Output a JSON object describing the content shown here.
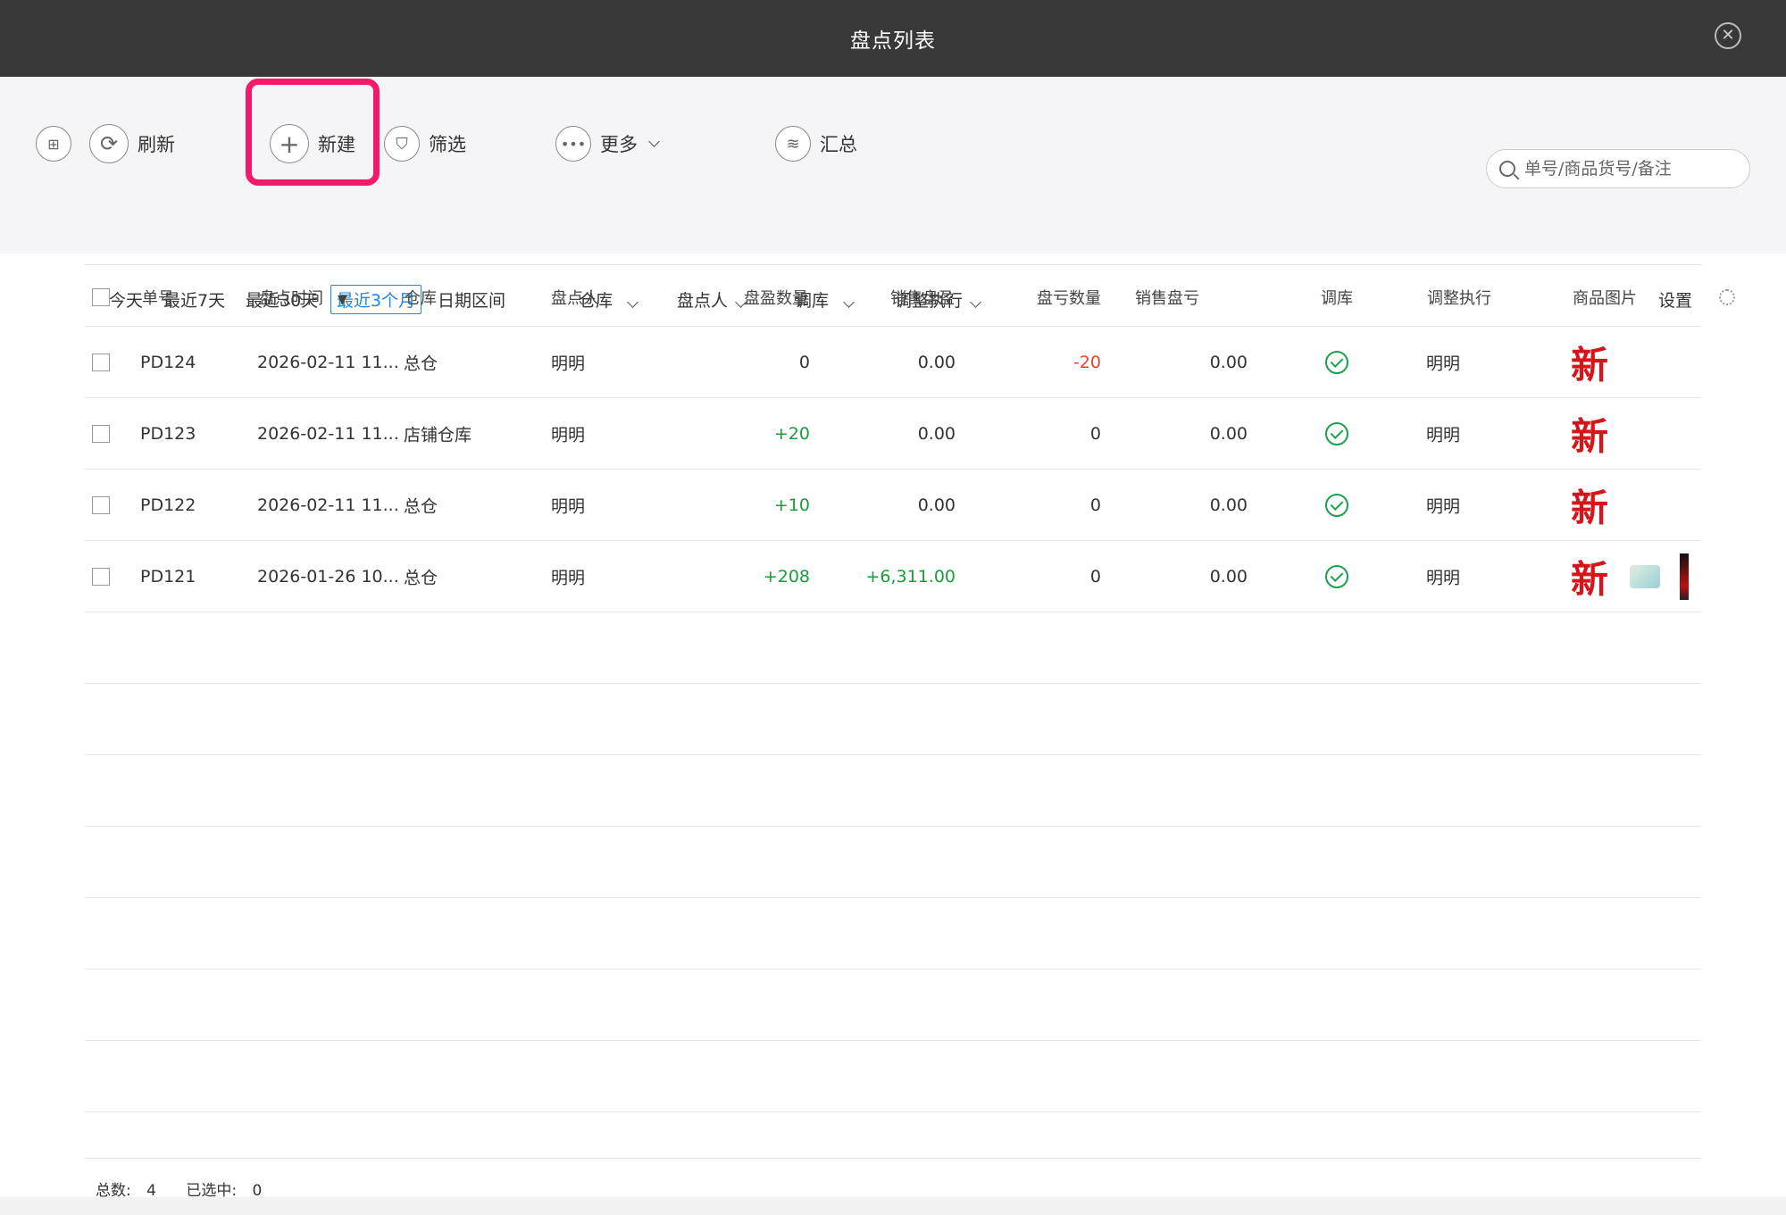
{
  "window": {
    "title": "盘点列表"
  },
  "toolbar": {
    "refresh_label": "刷新",
    "new_label": "新建",
    "filter_label": "筛选",
    "more_label": "更多",
    "summary_label": "汇总",
    "search_placeholder": "单号/商品货号/备注"
  },
  "filters": {
    "today": "今天",
    "last7": "最近7天",
    "last30": "最近30天",
    "last3m": "最近3个月",
    "range": "日期区间",
    "warehouse": "仓库",
    "counter": "盘点人",
    "adjust": "调库",
    "executor": "调整执行",
    "settings": "设置"
  },
  "table": {
    "columns": {
      "id": "单号",
      "time": "盘点时间",
      "sort_marker": "▼",
      "warehouse": "仓库",
      "counter": "盘点人",
      "gain_qty": "盘盈数量",
      "sales_gain": "销售盘盈",
      "loss_qty": "盘亏数量",
      "sales_loss": "销售盘亏",
      "adjust": "调库",
      "executor": "调整执行",
      "images": "商品图片"
    },
    "rows": [
      {
        "id": "PD124",
        "time": "2026-02-11 11...",
        "warehouse": "总仓",
        "counter": "明明",
        "gain_qty": "0",
        "sales_gain": "0.00",
        "loss_qty": "-20",
        "sales_loss": "0.00",
        "executor": "明明",
        "img": "新"
      },
      {
        "id": "PD123",
        "time": "2026-02-11 11...",
        "warehouse": "店铺仓库",
        "counter": "明明",
        "gain_qty": "+20",
        "sales_gain": "0.00",
        "loss_qty": "0",
        "sales_loss": "0.00",
        "executor": "明明",
        "img": "新"
      },
      {
        "id": "PD122",
        "time": "2026-02-11 11...",
        "warehouse": "总仓",
        "counter": "明明",
        "gain_qty": "+10",
        "sales_gain": "0.00",
        "loss_qty": "0",
        "sales_loss": "0.00",
        "executor": "明明",
        "img": "新"
      },
      {
        "id": "PD121",
        "time": "2026-01-26 10...",
        "warehouse": "总仓",
        "counter": "明明",
        "gain_qty": "+208",
        "sales_gain": "+6,311.00",
        "loss_qty": "0",
        "sales_loss": "0.00",
        "executor": "明明",
        "img": "新"
      }
    ]
  },
  "footer": {
    "total_label": "总数:",
    "total": "4",
    "selected_label": "已选中:",
    "selected": "0"
  },
  "colors": {
    "highlight": "#f21a6b",
    "positive": "#1a9b3c",
    "negative": "#e0462c",
    "accent": "#1e88e5"
  }
}
